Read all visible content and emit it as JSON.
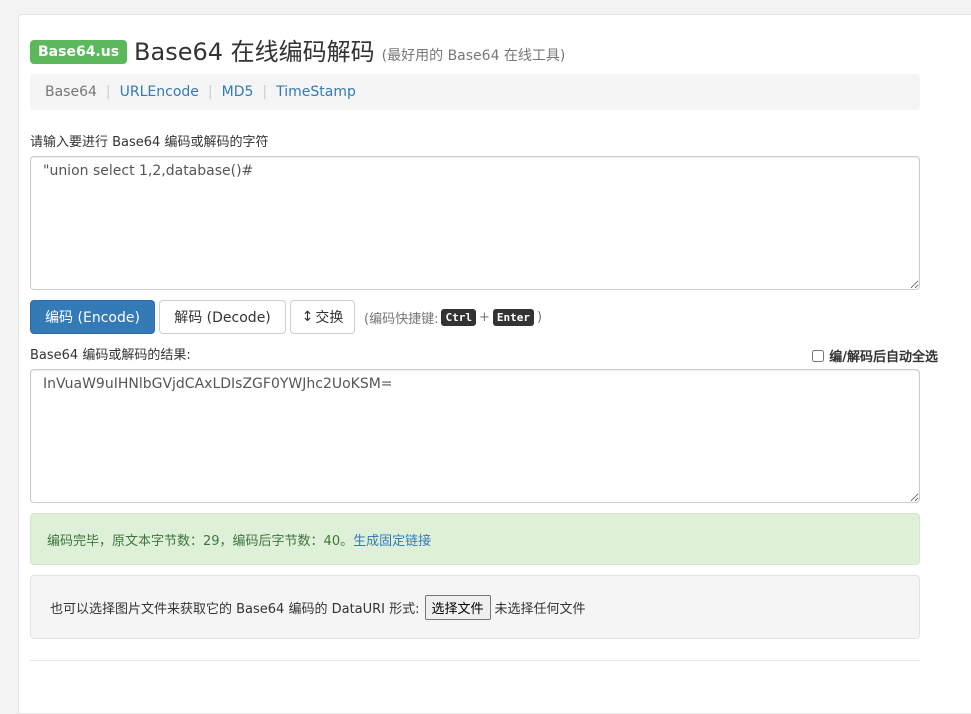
{
  "header": {
    "logo": "Base64.us",
    "title": "Base64 在线编码解码",
    "subtitle": "(最好用的 Base64 在线工具)"
  },
  "nav": {
    "items": [
      {
        "label": "Base64",
        "active": true
      },
      {
        "label": "URLEncode",
        "active": false
      },
      {
        "label": "MD5",
        "active": false
      },
      {
        "label": "TimeStamp",
        "active": false
      }
    ],
    "separator": "|"
  },
  "input": {
    "label": "请输入要进行 Base64 编码或解码的字符",
    "value": "\"union select 1,2,database()#"
  },
  "buttons": {
    "encode": "编码 (Encode)",
    "decode": "解码 (Decode)",
    "swap_icon": "↕",
    "swap": "交换",
    "hint_prefix": "(编码快捷键:",
    "key1": "Ctrl",
    "plus": "+",
    "key2": "Enter",
    "hint_suffix": ")"
  },
  "output": {
    "label": "Base64 编码或解码的结果:",
    "value": "InVuaW9uIHNlbGVjdCAxLDIsZGF0YWJhc2UoKSM=",
    "auto_select_label": "编/解码后自动全选",
    "auto_select_checked": false
  },
  "status": {
    "message": "编码完毕，原文本字节数：29，编码后字节数：40。",
    "link": "生成固定链接"
  },
  "file": {
    "prompt": "也可以选择图片文件来获取它的 Base64 编码的 DataURI 形式:",
    "button": "选择文件",
    "status": "未选择任何文件"
  },
  "colors": {
    "primary": "#337ab7",
    "success_bg": "#dff0d8",
    "success_text": "#3c763d",
    "logo_bg": "#5cb85c"
  }
}
